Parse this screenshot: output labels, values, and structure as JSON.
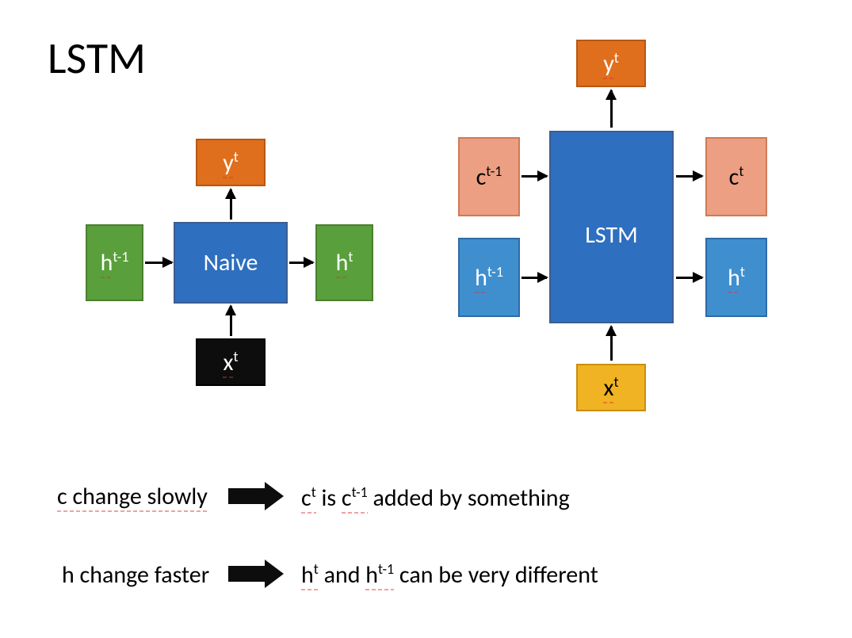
{
  "title": "LSTM",
  "naive": {
    "center": "Naive",
    "h_prev_base": "h",
    "h_prev_sup": "t-1",
    "h_next_base": "h",
    "h_next_sup": "t",
    "x_base": "x",
    "x_sup": "t",
    "y_base": "y",
    "y_sup": "t"
  },
  "lstm": {
    "center": "LSTM",
    "c_prev_base": "c",
    "c_prev_sup": "t-1",
    "c_next_base": "c",
    "c_next_sup": "t",
    "h_prev_base": "h",
    "h_prev_sup": "t-1",
    "h_next_base": "h",
    "h_next_sup": "t",
    "x_base": "x",
    "x_sup": "t",
    "y_base": "y",
    "y_sup": "t"
  },
  "notes": {
    "row1_left": "c change slowly",
    "row1_right_part1_base": "c",
    "row1_right_part1_sup": "t",
    "row1_right_mid": " is ",
    "row1_right_part2_base": "c",
    "row1_right_part2_sup": "t-1",
    "row1_right_tail": " added by something",
    "row2_left": "h change faster",
    "row2_right_part1_base": "h",
    "row2_right_part1_sup": "t",
    "row2_right_mid": " and ",
    "row2_right_part2_base": "h",
    "row2_right_part2_sup": "t-1",
    "row2_right_tail": " can be very different"
  },
  "colors": {
    "center_blue": "#2e6fbf",
    "green": "#599f3b",
    "orange": "#df6f1d",
    "black": "#0d0d0d",
    "light_blue": "#3f8fcf",
    "salmon": "#ec9f82",
    "gold": "#f0b323"
  }
}
